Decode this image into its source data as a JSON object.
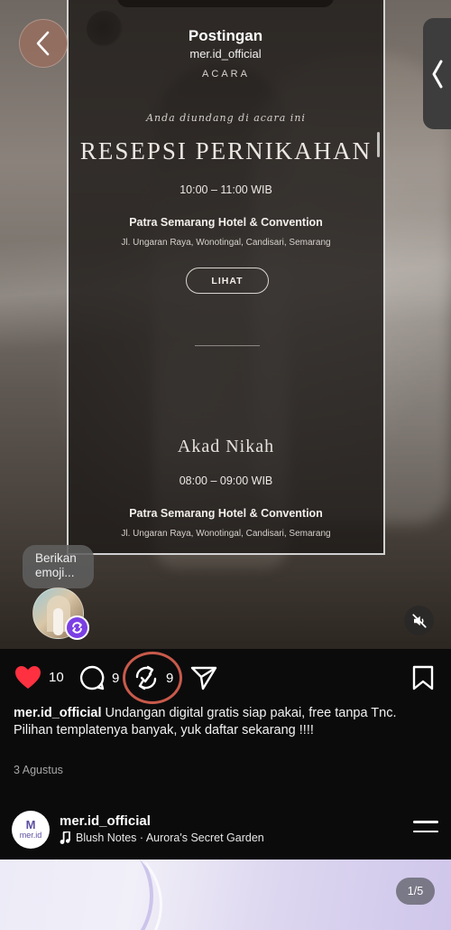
{
  "header": {
    "title": "Postingan",
    "subtitle": "mer.id_official"
  },
  "card": {
    "section_label": "ACARA",
    "invited_text": "Anda diundang di acara ini",
    "heading": "RESEPSI PERNIKAHAN",
    "time1": "10:00 – 11:00 WIB",
    "venue1": "Patra Semarang Hotel & Convention",
    "address1": "Jl. Ungaran Raya, Wonotingal, Candisari, Semarang",
    "button_label": "LIHAT",
    "heading2": "Akad Nikah",
    "time2": "08:00 – 09:00 WIB",
    "venue2": "Patra Semarang Hotel & Convention",
    "address2": "Jl. Ungaran Raya, Wonotingal, Candisari, Semarang"
  },
  "emoji_prompt": "Berikan emoji...",
  "actions": {
    "likes": "10",
    "comments": "9",
    "reposts": "9"
  },
  "caption": {
    "username": "mer.id_official",
    "text_line1": " Undangan digital gratis siap pakai, free tanpa Tnc.",
    "text_line2": "Pilihan templatenya banyak, yuk daftar sekarang !!!!",
    "date": "3 Agustus"
  },
  "now_playing": {
    "avatar_text_top": "M",
    "avatar_text_bottom": "mer.id",
    "username": "mer.id_official",
    "track": "Blush Notes · Aurora's Secret Garden"
  },
  "page_indicator": "1/5",
  "colors": {
    "like_red": "#ff3040",
    "repost_badge": "#7b3fe4",
    "highlight_ring": "#c85a4a",
    "background": "#0b0b0c"
  },
  "icons": [
    "back-icon",
    "side-tab-chevron-icon",
    "heart-icon",
    "comment-icon",
    "repost-icon",
    "send-icon",
    "bookmark-icon",
    "mute-icon",
    "music-note-icon",
    "menu-icon"
  ]
}
